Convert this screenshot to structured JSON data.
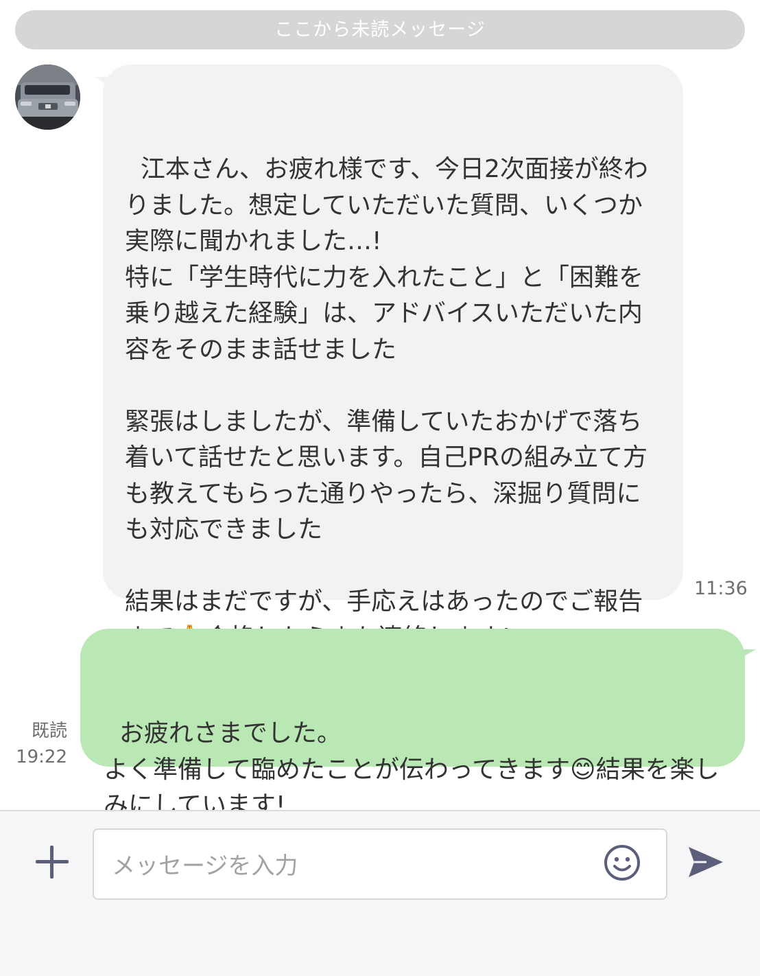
{
  "chat": {
    "unread_divider": "ここから未読メッセージ",
    "incoming": {
      "text": "江本さん、お疲れ様です、今日2次面接が終わりました。想定していただいた質問、いくつか実際に聞かれました…!\n特に「学生時代に力を入れたこと」と「困難を乗り越えた経験」は、アドバイスいただいた内容をそのまま話せました\n\n緊張はしましたが、準備していたおかげで落ち着いて話せたと思います。自己PRの組み立て方も教えてもらった通りやったら、深掘り質問にも対応できました\n\n結果はまだですが、手応えはあったのでご報告まで🙏合格したらまた連絡します!",
      "time": "11:36"
    },
    "outgoing": {
      "text": "お疲れさまでした。\nよく準備して臨めたことが伝わってきます😊結果を楽しみにしています!",
      "read_label": "既読",
      "time": "19:22"
    }
  },
  "input_bar": {
    "placeholder": "メッセージを入力",
    "value": "",
    "plus_icon": "plus-icon",
    "emoji_icon": "smiley-icon",
    "send_icon": "send-icon"
  },
  "colors": {
    "incoming_bubble": "#f2f2f4",
    "outgoing_bubble": "#b9e8b5",
    "divider": "#d6d6d6",
    "icon": "#5b5f7a"
  }
}
